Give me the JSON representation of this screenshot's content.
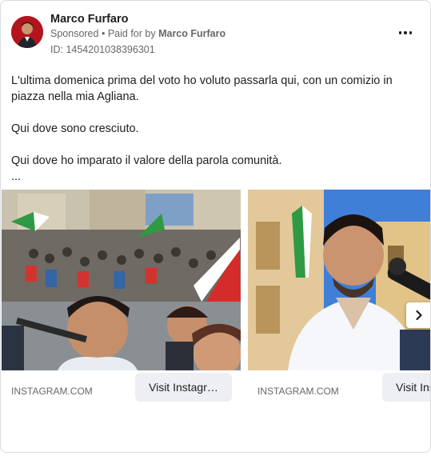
{
  "post": {
    "author_name": "Marco Furfaro",
    "sponsored_label": "Sponsored",
    "separator": "•",
    "paid_for_prefix": "Paid for by",
    "paid_for_name": "Marco Furfaro",
    "ad_id": "ID: 1454201038396301",
    "more_icon": "more-dots-icon",
    "body": {
      "line1": "L'ultima domenica prima del voto ho voluto passarla qui, con un comizio in piazza nella mia Agliana.",
      "line2": "Qui dove sono cresciuto.",
      "line3": "Qui dove ho imparato il valore della parola comunità.",
      "line4": "..."
    }
  },
  "carousel": {
    "cards": [
      {
        "domain": "INSTAGRAM.COM",
        "button_label": "Visit Instagr…",
        "image": "rally-selfie-photo"
      },
      {
        "domain": "INSTAGRAM.COM",
        "button_label": "Visit Ins",
        "image": "speaker-microphone-photo"
      }
    ],
    "next_icon": "chevron-right-icon"
  },
  "colors": {
    "text_primary": "#1c1e21",
    "text_secondary": "#65676b",
    "button_bg": "#eeeff2",
    "flag_green": "#2e9a43",
    "flag_red": "#d62b2b",
    "sky": "#3f7fd8"
  }
}
